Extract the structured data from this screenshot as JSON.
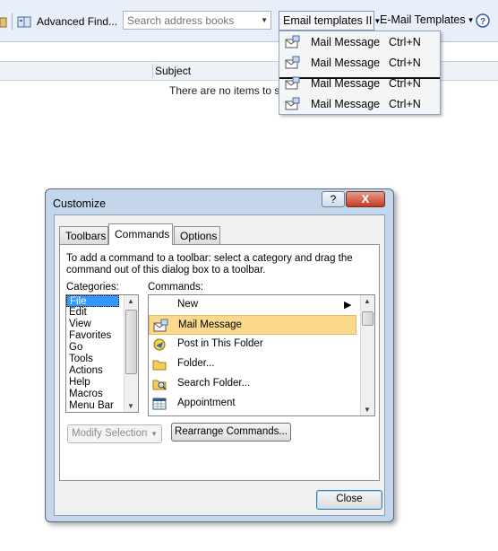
{
  "toolbar": {
    "advanced_find": "Advanced Find...",
    "search_placeholder": "Search address books",
    "email_templates_1": "Email templates II",
    "email_templates_2": "E-Mail Templates"
  },
  "list": {
    "column_subject": "Subject",
    "empty_message": "There are no items to sh"
  },
  "menu": {
    "items": [
      {
        "label": "Mail Message",
        "shortcut": "Ctrl+N"
      },
      {
        "label": "Mail Message",
        "shortcut": "Ctrl+N"
      },
      {
        "label": "Mail Message",
        "shortcut": "Ctrl+N"
      },
      {
        "label": "Mail Message",
        "shortcut": "Ctrl+N"
      }
    ]
  },
  "dialog": {
    "title": "Customize",
    "help_label": "?",
    "close_label": "X",
    "tabs": [
      "Toolbars",
      "Commands",
      "Options"
    ],
    "active_tab": "Commands",
    "instructions": "To add a command to a toolbar: select a category and drag the command out of this dialog box to a toolbar.",
    "categories_label": "Categories:",
    "commands_label": "Commands:",
    "categories": [
      "File",
      "Edit",
      "View",
      "Favorites",
      "Go",
      "Tools",
      "Actions",
      "Help",
      "Macros",
      "Menu Bar"
    ],
    "selected_category": "File",
    "commands": [
      {
        "label": "New",
        "icon": "none",
        "submenu": true
      },
      {
        "label": "Mail Message",
        "icon": "mail-message-icon"
      },
      {
        "label": "Post in This Folder",
        "icon": "post-icon"
      },
      {
        "label": "Folder...",
        "icon": "folder-icon"
      },
      {
        "label": "Search Folder...",
        "icon": "search-folder-icon"
      },
      {
        "label": "Appointment",
        "icon": "calendar-icon"
      }
    ],
    "highlighted_command": "Mail Message",
    "modify_selection": "Modify Selection",
    "rearrange_commands": "Rearrange Commands...",
    "close_button": "Close"
  }
}
